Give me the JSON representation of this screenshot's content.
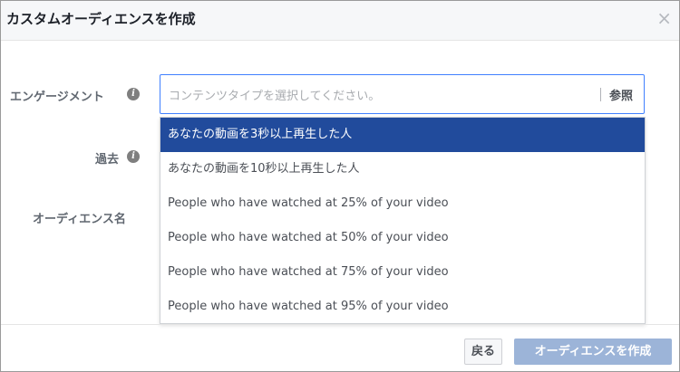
{
  "dialog": {
    "title": "カスタムオーディエンスを作成",
    "close_icon": "close-icon"
  },
  "form": {
    "engagement_label": "エンゲージメント",
    "period_label": "過去",
    "audience_name_label": "オーディエンス名",
    "info_icon": "info-icon",
    "info_glyph": "i"
  },
  "combo": {
    "placeholder": "コンテンツタイプを選択してください。",
    "browse_label": "参照"
  },
  "dropdown": {
    "options": [
      {
        "label": "あなたの動画を3秒以上再生した人",
        "selected": true
      },
      {
        "label": "あなたの動画を10秒以上再生した人",
        "selected": false
      },
      {
        "label": "People who have watched at 25% of your video",
        "selected": false
      },
      {
        "label": "People who have watched at 50% of your video",
        "selected": false
      },
      {
        "label": "People who have watched at 75% of your video",
        "selected": false
      },
      {
        "label": "People who have watched at 95% of your video",
        "selected": false
      }
    ]
  },
  "footer": {
    "back_label": "戻る",
    "create_label": "オーディエンスを作成"
  },
  "colors": {
    "selected_option_bg": "#214b9c",
    "primary_button_disabled": "#9cb4d8",
    "focus_border": "#4080ff"
  }
}
